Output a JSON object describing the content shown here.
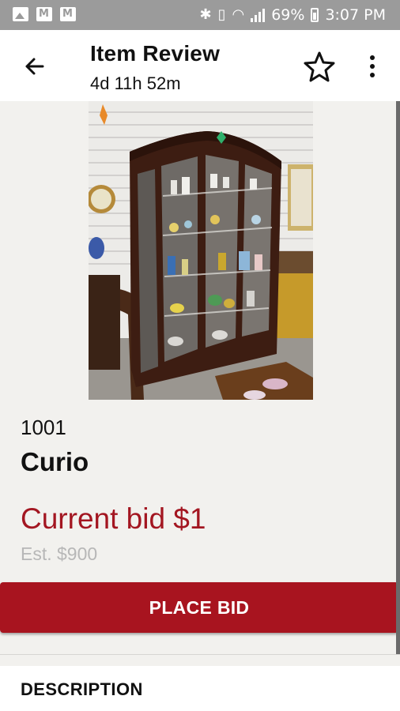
{
  "status_bar": {
    "battery": "69%",
    "time": "3:07 PM",
    "icons": [
      "image-notification-icon",
      "gmail-icon",
      "gmail-icon",
      "bluetooth-icon",
      "vibrate-icon",
      "wifi-icon",
      "signal-icon",
      "battery-icon"
    ]
  },
  "app_bar": {
    "title": "Item Review",
    "time_left": "4d 11h 52m",
    "icons": [
      "back-arrow-icon",
      "star-outline-icon",
      "more-vert-icon"
    ]
  },
  "item": {
    "lot_number": "1001",
    "name": "Curio",
    "current_bid": "Current bid $1",
    "estimate": "Est. $900"
  },
  "actions": {
    "place_bid_label": "PLACE BID"
  },
  "description": {
    "heading": "DESCRIPTION"
  },
  "colors": {
    "brand": "#a8141f",
    "bid_text": "#a31621",
    "estimate_text": "#b7b7b7",
    "background": "#f2f1ee",
    "status_bar": "#9b9b9b"
  }
}
